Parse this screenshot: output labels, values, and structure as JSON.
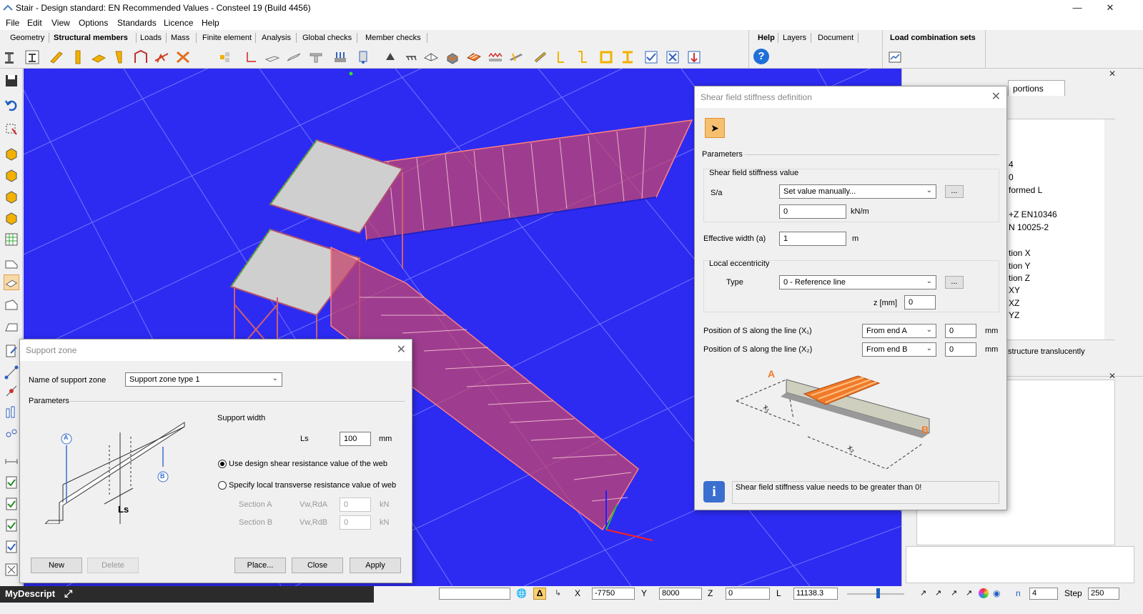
{
  "window": {
    "title": "Stair - Design standard: EN Recommended Values - Consteel 19 (Build 4456)",
    "minimize": "—",
    "maximize": "❐",
    "close": "✕"
  },
  "menu": [
    "File",
    "Edit",
    "View",
    "Options",
    "Standards",
    "Licence",
    "Help"
  ],
  "ribbon_tabs": [
    "Geometry",
    "Structural members",
    "Loads",
    "Mass",
    "Finite element",
    "Analysis",
    "Global checks",
    "Member checks"
  ],
  "ribbon_tabs_right": [
    "Help",
    "Layers",
    "Document"
  ],
  "ribbon_load_combo": "Load combination sets",
  "right_panel": {
    "tab_partial": "portions",
    "list_fragments": [
      "4",
      "0",
      "formed L",
      "+Z EN10346",
      "N 10025-2",
      "tion X",
      "tion Y",
      "tion Z",
      "XY",
      "XZ",
      "YZ"
    ],
    "translucent": "structure translucently"
  },
  "shear_dialog": {
    "title": "Shear field stiffness definition",
    "parameters": "Parameters",
    "stiffness_group": "Shear field stiffness value",
    "sa_label": "S/a",
    "sa_select": "Set value manually...",
    "sa_value": "0",
    "sa_unit": "kN/m",
    "browse": "...",
    "eff_width_label": "Effective width (a)",
    "eff_width_value": "1",
    "eff_width_unit": "m",
    "ecc_group": "Local eccentricity",
    "type_label": "Type",
    "type_select": "0 - Reference line",
    "z_label": "z [mm]",
    "z_value": "0",
    "pos1_label": "Position of S along the line (X₁)",
    "pos1_select": "From end A",
    "pos1_value": "0",
    "pos2_label": "Position of S along the line (X₂)",
    "pos2_select": "From end B",
    "pos2_value": "0",
    "pos_unit": "mm",
    "diagram_a": "A",
    "diagram_b": "B",
    "diagram_x1": "x₁",
    "diagram_x2": "x₂",
    "info_icon": "i",
    "message": "Shear field stiffness value needs to be greater than 0!"
  },
  "support_dialog": {
    "title": "Support zone",
    "name_label": "Name of support zone",
    "name_select": "Support zone type 1",
    "parameters": "Parameters",
    "support_width": "Support width",
    "ls_label": "Ls",
    "ls_value": "100",
    "ls_unit": "mm",
    "radio1": "Use design shear resistance value of the web",
    "radio1_checked": true,
    "radio2": "Specify local transverse resistance value of web",
    "section_a": "Section A",
    "section_b": "Section B",
    "vwa_label": "Vw,RdA",
    "vwb_label": "Vw,RdB",
    "vwa_value": "0",
    "vwb_value": "0",
    "kn": "kN",
    "diagram_a": "A",
    "diagram_b": "B",
    "diagram_ls": "Ls",
    "btn_new": "New",
    "btn_delete": "Delete",
    "btn_place": "Place...",
    "btn_close": "Close",
    "btn_apply": "Apply"
  },
  "statusbar": {
    "description": "MyDescript",
    "x_label": "X",
    "x_value": "-7750",
    "y_label": "Y",
    "y_value": "8000",
    "z_label": "Z",
    "z_value": "0",
    "l_label": "L",
    "l_value": "11138.3",
    "n_label": "n",
    "n_value": "4",
    "step_label": "Step",
    "step_value": "250"
  },
  "colors": {
    "viewport": "#2d2bf2",
    "stair_fill": "#c4446e",
    "platform": "#cfcfcf",
    "accent_orange": "#f07a2a",
    "info_blue": "#3a6fd0"
  }
}
